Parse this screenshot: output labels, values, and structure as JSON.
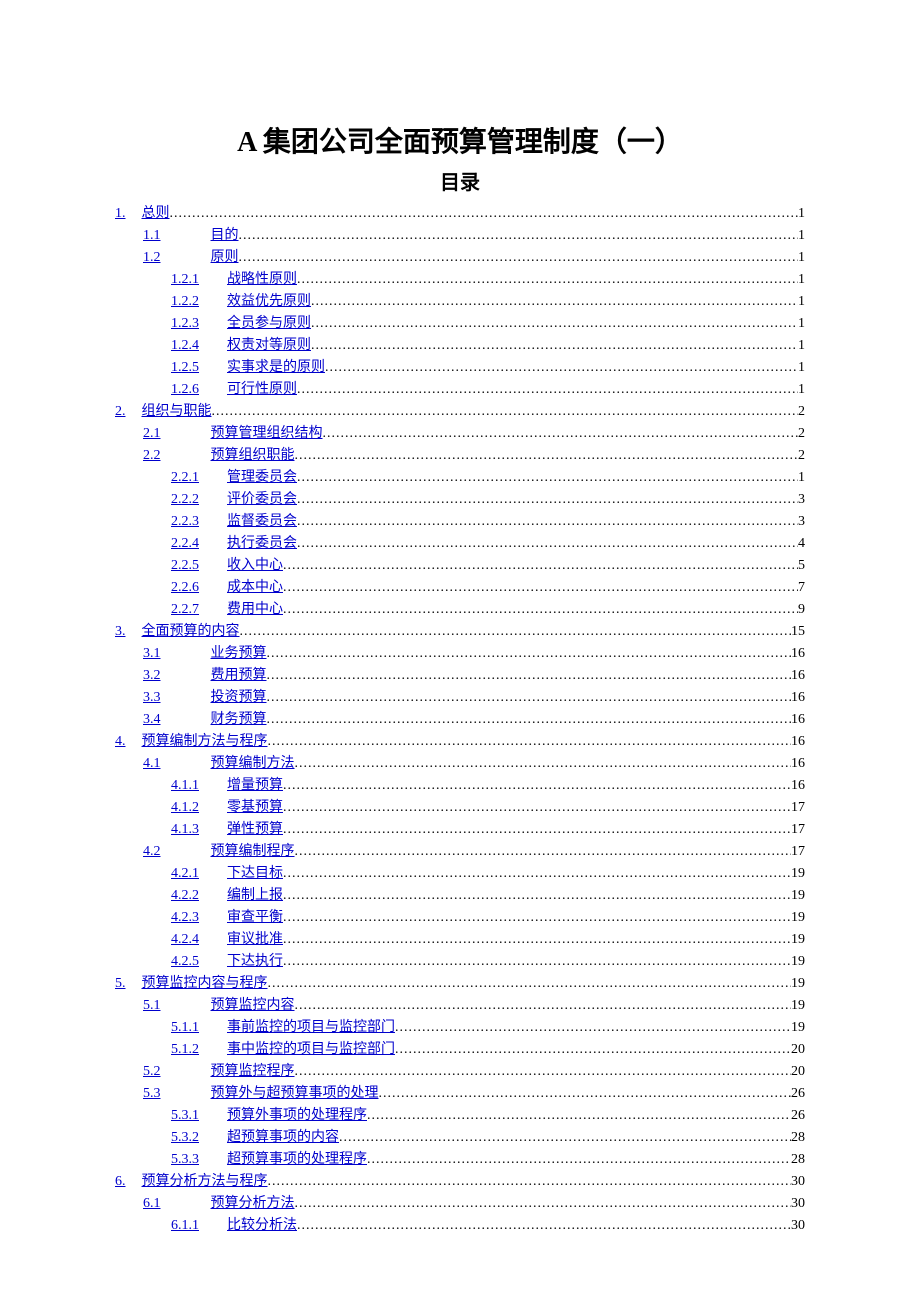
{
  "title_main": "A 集团公司全面预算管理制度（一）",
  "title_sub": "目录",
  "dots": "...........................................................................................................................................................................................",
  "toc": [
    {
      "num": "1.",
      "label": "总则",
      "page": "1",
      "indent": 0,
      "numGap": 16,
      "labelGap": 0
    },
    {
      "num": "1.1",
      "label": "目的",
      "page": "1",
      "indent": 1,
      "numGap": 50,
      "labelGap": 0
    },
    {
      "num": "1.2",
      "label": "原则",
      "page": "1",
      "indent": 1,
      "numGap": 50,
      "labelGap": 0
    },
    {
      "num": "1.2.1",
      "label": "战略性原则",
      "page": "1",
      "indent": 2,
      "numGap": 28,
      "labelGap": 0
    },
    {
      "num": "1.2.2",
      "label": "效益优先原则",
      "page": "1",
      "indent": 2,
      "numGap": 28,
      "labelGap": 0
    },
    {
      "num": "1.2.3",
      "label": "全员参与原则",
      "page": "1",
      "indent": 2,
      "numGap": 28,
      "labelGap": 0
    },
    {
      "num": "1.2.4",
      "label": "权责对等原则",
      "page": "1",
      "indent": 2,
      "numGap": 28,
      "labelGap": 0
    },
    {
      "num": "1.2.5",
      "label": "实事求是的原则",
      "page": "1",
      "indent": 2,
      "numGap": 28,
      "labelGap": 0
    },
    {
      "num": "1.2.6",
      "label": "可行性原则",
      "page": "1",
      "indent": 2,
      "numGap": 28,
      "labelGap": 0
    },
    {
      "num": "2.",
      "label": "组织与职能",
      "page": "2",
      "indent": 0,
      "numGap": 16,
      "labelGap": 0
    },
    {
      "num": "2.1",
      "label": "预算管理组织结构",
      "page": "2",
      "indent": 1,
      "numGap": 50,
      "labelGap": 0
    },
    {
      "num": "2.2",
      "label": "预算组织职能",
      "page": "2",
      "indent": 1,
      "numGap": 50,
      "labelGap": 0
    },
    {
      "num": "2.2.1",
      "label": "管理委员会",
      "page": "1",
      "indent": 2,
      "numGap": 28,
      "labelGap": 0
    },
    {
      "num": "2.2.2",
      "label": "评价委员会",
      "page": "3",
      "indent": 2,
      "numGap": 28,
      "labelGap": 0
    },
    {
      "num": "2.2.3",
      "label": "监督委员会",
      "page": "3",
      "indent": 2,
      "numGap": 28,
      "labelGap": 0
    },
    {
      "num": "2.2.4",
      "label": "执行委员会",
      "page": "4",
      "indent": 2,
      "numGap": 28,
      "labelGap": 0
    },
    {
      "num": "2.2.5",
      "label": "收入中心",
      "page": "5",
      "indent": 2,
      "numGap": 28,
      "labelGap": 0
    },
    {
      "num": "2.2.6",
      "label": "成本中心",
      "page": "7",
      "indent": 2,
      "numGap": 28,
      "labelGap": 0
    },
    {
      "num": "2.2.7",
      "label": "费用中心",
      "page": "9",
      "indent": 2,
      "numGap": 28,
      "labelGap": 0
    },
    {
      "num": "3.",
      "label": "全面预算的内容",
      "page": "15",
      "indent": 0,
      "numGap": 16,
      "labelGap": 0
    },
    {
      "num": "3.1",
      "label": "业务预算",
      "page": "16",
      "indent": 1,
      "numGap": 50,
      "labelGap": 0
    },
    {
      "num": "3.2",
      "label": "费用预算",
      "page": "16",
      "indent": 1,
      "numGap": 50,
      "labelGap": 0
    },
    {
      "num": "3.3",
      "label": "投资预算",
      "page": "16",
      "indent": 1,
      "numGap": 50,
      "labelGap": 0
    },
    {
      "num": "3.4",
      "label": "财务预算",
      "page": "16",
      "indent": 1,
      "numGap": 50,
      "labelGap": 0
    },
    {
      "num": "4.",
      "label": "预算编制方法与程序",
      "page": "16",
      "indent": 0,
      "numGap": 16,
      "labelGap": 0
    },
    {
      "num": "4.1",
      "label": "预算编制方法",
      "page": "16",
      "indent": 1,
      "numGap": 50,
      "labelGap": 0
    },
    {
      "num": "4.1.1",
      "label": "增量预算",
      "page": "16",
      "indent": 2,
      "numGap": 28,
      "labelGap": 0
    },
    {
      "num": "4.1.2",
      "label": "零基预算",
      "page": "17",
      "indent": 2,
      "numGap": 28,
      "labelGap": 0
    },
    {
      "num": "4.1.3",
      "label": "弹性预算",
      "page": "17",
      "indent": 2,
      "numGap": 28,
      "labelGap": 0
    },
    {
      "num": "4.2",
      "label": "预算编制程序",
      "page": "17",
      "indent": 1,
      "numGap": 50,
      "labelGap": 0
    },
    {
      "num": "4.2.1",
      "label": "下达目标",
      "page": "19",
      "indent": 2,
      "numGap": 28,
      "labelGap": 0
    },
    {
      "num": "4.2.2",
      "label": "编制上报",
      "page": "19",
      "indent": 2,
      "numGap": 28,
      "labelGap": 0
    },
    {
      "num": "4.2.3",
      "label": "审查平衡",
      "page": "19",
      "indent": 2,
      "numGap": 28,
      "labelGap": 0
    },
    {
      "num": "4.2.4",
      "label": "审议批准",
      "page": "19",
      "indent": 2,
      "numGap": 28,
      "labelGap": 0
    },
    {
      "num": "4.2.5",
      "label": "下达执行",
      "page": "19",
      "indent": 2,
      "numGap": 28,
      "labelGap": 0
    },
    {
      "num": "5.",
      "label": "预算监控内容与程序",
      "page": "19",
      "indent": 0,
      "numGap": 16,
      "labelGap": 0
    },
    {
      "num": "5.1",
      "label": "预算监控内容",
      "page": "19",
      "indent": 1,
      "numGap": 50,
      "labelGap": 0
    },
    {
      "num": "5.1.1",
      "label": "事前监控的项目与监控部门",
      "page": "19",
      "indent": 2,
      "numGap": 28,
      "labelGap": 0
    },
    {
      "num": "5.1.2",
      "label": "事中监控的项目与监控部门",
      "page": "20",
      "indent": 2,
      "numGap": 28,
      "labelGap": 0
    },
    {
      "num": "5.2",
      "label": "预算监控程序",
      "page": "20",
      "indent": 1,
      "numGap": 50,
      "labelGap": 0
    },
    {
      "num": "5.3",
      "label": "预算外与超预算事项的处理",
      "page": "26",
      "indent": 1,
      "numGap": 50,
      "labelGap": 0
    },
    {
      "num": "5.3.1",
      "label": "预算外事项的处理程序",
      "page": "26",
      "indent": 2,
      "numGap": 28,
      "labelGap": 0
    },
    {
      "num": "5.3.2",
      "label": "超预算事项的内容",
      "page": "28",
      "indent": 2,
      "numGap": 28,
      "labelGap": 0
    },
    {
      "num": "5.3.3",
      "label": "超预算事项的处理程序",
      "page": "28",
      "indent": 2,
      "numGap": 28,
      "labelGap": 0
    },
    {
      "num": "6.",
      "label": "预算分析方法与程序",
      "page": "30",
      "indent": 0,
      "numGap": 16,
      "labelGap": 0
    },
    {
      "num": "6.1",
      "label": "预算分析方法",
      "page": "30",
      "indent": 1,
      "numGap": 50,
      "labelGap": 0
    },
    {
      "num": "6.1.1",
      "label": "比较分析法",
      "page": "30",
      "indent": 2,
      "numGap": 28,
      "labelGap": 0
    }
  ]
}
